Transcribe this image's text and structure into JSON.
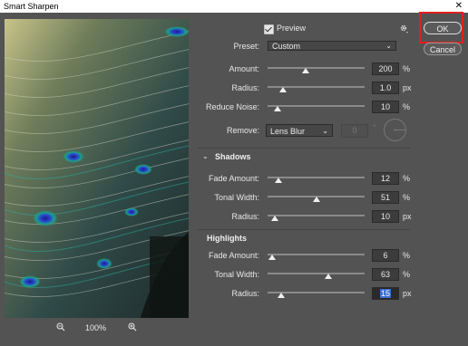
{
  "window": {
    "title": "Smart Sharpen",
    "close_glyph": "✕"
  },
  "preview_toggle": {
    "label": "Preview",
    "checked": true
  },
  "gear_icon": "gear-icon",
  "preset": {
    "label": "Preset:",
    "value": "Custom"
  },
  "main": {
    "amount": {
      "label": "Amount:",
      "value": "200",
      "unit": "%",
      "level": 0.5
    },
    "radius": {
      "label": "Radius:",
      "value": "1.0",
      "unit": "px",
      "level": 0.08
    },
    "reduce_noise": {
      "label": "Reduce Noise:",
      "value": "10",
      "unit": "%",
      "level": 0.1
    }
  },
  "remove": {
    "label": "Remove:",
    "value": "Lens Blur",
    "angle_value": "0",
    "degree": "°"
  },
  "shadows": {
    "title": "Shadows",
    "fade_amount": {
      "label": "Fade Amount:",
      "value": "12",
      "unit": "%",
      "level": 0.12
    },
    "tonal_width": {
      "label": "Tonal Width:",
      "value": "51",
      "unit": "%",
      "level": 0.51
    },
    "radius": {
      "label": "Radius:",
      "value": "10",
      "unit": "px",
      "level": 0.05
    }
  },
  "highlights": {
    "title": "Highlights",
    "fade_amount": {
      "label": "Fade Amount:",
      "value": "6",
      "unit": "%",
      "level": 0.06
    },
    "tonal_width": {
      "label": "Tonal Width:",
      "value": "63",
      "unit": "%",
      "level": 0.63
    },
    "radius": {
      "label": "Radius:",
      "value": "15",
      "unit": "px",
      "level": 0.1
    }
  },
  "buttons": {
    "ok": "OK",
    "cancel": "Cancel"
  },
  "zoom": {
    "value": "100%"
  },
  "colors": {
    "highlight": "#e02020",
    "selection": "#3b6fd1"
  }
}
